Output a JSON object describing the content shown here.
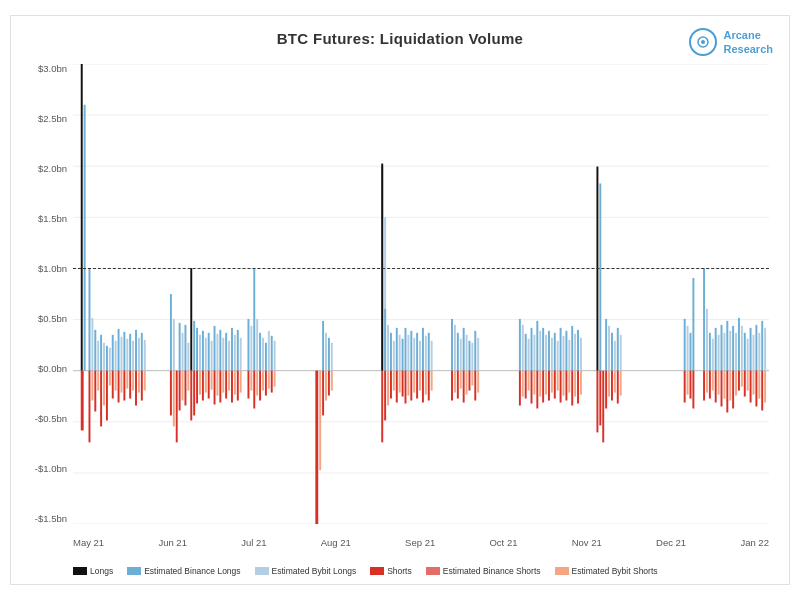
{
  "chart": {
    "title": "BTC Futures: Liquidation Volume",
    "brand": {
      "name": "Arcane Research",
      "line1": "Arcane",
      "line2": "Research"
    },
    "yAxis": {
      "labels": [
        "$3.0bn",
        "$2.5bn",
        "$2.0bn",
        "$1.5bn",
        "$1.0bn",
        "$0.5bn",
        "$0.0bn",
        "-$0.5bn",
        "-$1.0bn",
        "-$1.5bn"
      ]
    },
    "xAxis": {
      "labels": [
        "May 21",
        "Jun 21",
        "Jul 21",
        "Aug 21",
        "Sep 21",
        "Oct 21",
        "Nov 21",
        "Dec 21",
        "Jan 22"
      ]
    },
    "legend": [
      {
        "label": "Longs",
        "color": "#111111",
        "type": "solid"
      },
      {
        "label": "Estimated Binance Longs",
        "color": "#6baed6",
        "type": "solid"
      },
      {
        "label": "Estimated Bybit Longs",
        "color": "#b3cde3",
        "type": "solid"
      },
      {
        "label": "Shorts",
        "color": "#d73027",
        "type": "solid"
      },
      {
        "label": "Estimated Binance Shorts",
        "color": "#d73027",
        "type": "solid"
      },
      {
        "label": "Estimated Bybit Shorts",
        "color": "#f4a582",
        "type": "solid"
      }
    ],
    "dashedLineValue": "$1.0bn",
    "colors": {
      "longsBlack": "#111111",
      "longsBlue": "#6baed6",
      "longsLightBlue": "#b3cde3",
      "shortsRed": "#d73027",
      "shortsLightRed": "#f4a582"
    }
  }
}
